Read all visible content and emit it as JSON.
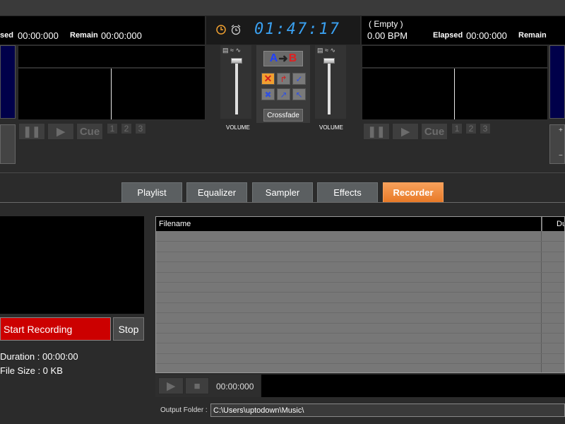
{
  "deck_left": {
    "elapsed_label": "sed",
    "elapsed_value": "00:00:000",
    "remain_label": "Remain",
    "remain_value": "00:00:000",
    "cue_label": "Cue",
    "hotcues": [
      "1",
      "2",
      "3"
    ]
  },
  "deck_right": {
    "track_title": "( Empty )",
    "bpm": "0.00 BPM",
    "elapsed_label": "Elapsed",
    "elapsed_value": "00:00:000",
    "remain_label": "Remain",
    "cue_label": "Cue",
    "hotcues": [
      "1",
      "2",
      "3"
    ]
  },
  "clock": {
    "time": "01:47:17"
  },
  "mixer": {
    "ab_a": "A",
    "ab_b": "B",
    "crossfade_label": "Crossfade",
    "volume_left_label": "VOLUME",
    "volume_right_label": "VOLUME",
    "volume_left_level": 1.0,
    "volume_right_level": 1.0
  },
  "tabs": [
    {
      "label": "Playlist",
      "active": false
    },
    {
      "label": "Equalizer",
      "active": false
    },
    {
      "label": "Sampler",
      "active": false
    },
    {
      "label": "Effects",
      "active": false
    },
    {
      "label": "Recorder",
      "active": true
    }
  ],
  "recorder": {
    "start_label": "Start Recording",
    "stop_label": "Stop",
    "duration_label": "Duration : 00:00:00",
    "filesize_label": "File Size : 0 KB",
    "columns": [
      "Filename",
      "Du"
    ],
    "playback_time": "00:00:000",
    "output_folder_label": "Output Folder :",
    "output_folder_value": "C:\\Users\\uptodown\\Music\\"
  },
  "colors": {
    "record_red": "#cc0000",
    "active_tab": "#f08a3c",
    "clock_blue": "#3aa0f0"
  }
}
